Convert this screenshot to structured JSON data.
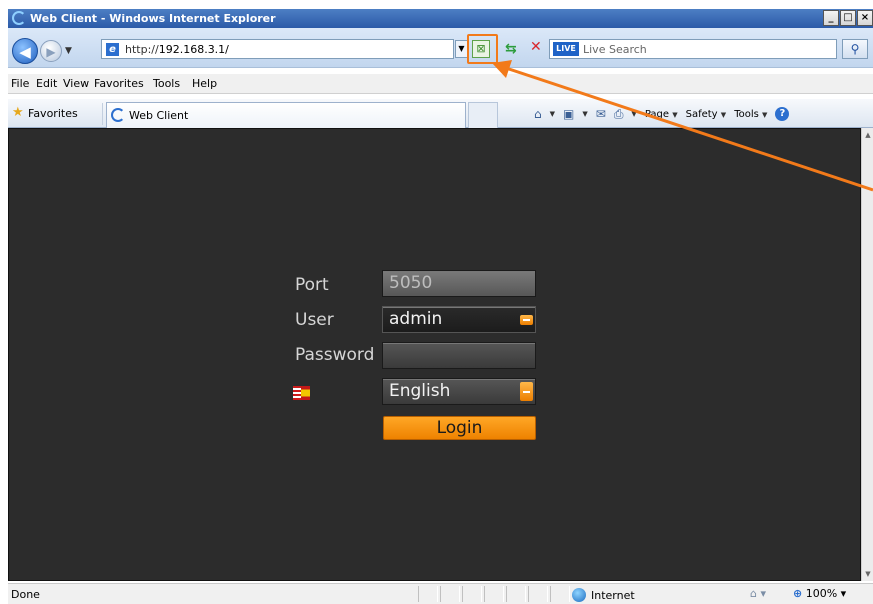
{
  "window": {
    "title": "Web Client - Windows Internet Explorer",
    "controls": {
      "minimize": "_",
      "maximize": "□",
      "close": "×"
    }
  },
  "address_bar": {
    "url_prefix": "http://",
    "url_host": "192.168.3.1/"
  },
  "search": {
    "provider_logo": "LIVE",
    "placeholder": "Live Search"
  },
  "menu": [
    "File",
    "Edit",
    "View",
    "Favorites",
    "Tools",
    "Help"
  ],
  "favorites_bar": {
    "favorites_label": "Favorites",
    "tab_label": "Web Client"
  },
  "command_bar": {
    "page": "Page",
    "safety": "Safety",
    "tools": "Tools",
    "help": "?"
  },
  "login_form": {
    "port_label": "Port",
    "port_value": "5050",
    "user_label": "User",
    "user_value": "admin",
    "password_label": "Password",
    "password_value": "",
    "language_value": "English",
    "login_button": "Login"
  },
  "status_bar": {
    "status": "Done",
    "zone": "Internet",
    "zoom": "100%"
  },
  "colors": {
    "accent_orange": "#ee8200",
    "content_background": "#2c2c2c",
    "highlight_callout": "#f27a1a"
  },
  "icons": [
    "ie-logo-icon",
    "back-icon",
    "forward-icon",
    "page-icon",
    "compatibility-view-icon",
    "refresh-icon",
    "stop-icon",
    "search-icon",
    "favorites-star-icon",
    "home-icon",
    "feeds-icon",
    "mail-icon",
    "print-icon",
    "help-icon",
    "language-flag-icon",
    "internet-zone-icon",
    "zoom-icon"
  ]
}
